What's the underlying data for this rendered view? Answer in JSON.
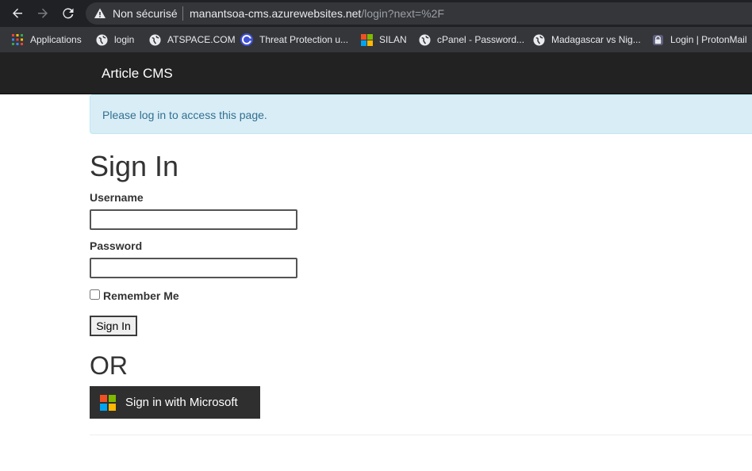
{
  "browser": {
    "security_label": "Non sécurisé",
    "url_host": "manantsoa-cms.azurewebsites.net",
    "url_path": "/login?next=%2F",
    "icons": {
      "back": "arrow-left-icon",
      "forward": "arrow-right-icon",
      "reload": "reload-icon",
      "warning": "warning-triangle-icon"
    }
  },
  "bookmarks": [
    {
      "label": "Applications",
      "icon": "apps-grid-icon"
    },
    {
      "label": "login",
      "icon": "globe-icon"
    },
    {
      "label": "ATSPACE.COM",
      "icon": "globe-icon"
    },
    {
      "label": "Threat Protection u...",
      "icon": "threat-protection-icon"
    },
    {
      "label": "SILAN",
      "icon": "windows-logo-icon"
    },
    {
      "label": "cPanel - Password...",
      "icon": "globe-icon"
    },
    {
      "label": "Madagascar vs Nig...",
      "icon": "globe-icon"
    },
    {
      "label": "Login | ProtonMail",
      "icon": "protonmail-icon"
    }
  ],
  "site": {
    "brand": "Article CMS",
    "alert": "Please log in to access this page."
  },
  "form": {
    "title": "Sign In",
    "username_label": "Username",
    "username_value": "",
    "password_label": "Password",
    "password_value": "",
    "remember_label": "Remember Me",
    "remember_checked": false,
    "submit_label": "Sign In",
    "or_label": "OR",
    "microsoft_label": "Sign in with Microsoft"
  },
  "colors": {
    "chrome_bg": "#202124",
    "bookmarks_bg": "#35363a",
    "navbar_bg": "#222222",
    "alert_bg": "#d9edf7",
    "alert_text": "#31708f",
    "ms_button_bg": "#2f2f2f",
    "ms_red": "#f25022",
    "ms_green": "#7fba00",
    "ms_blue": "#00a4ef",
    "ms_yellow": "#ffb900"
  }
}
